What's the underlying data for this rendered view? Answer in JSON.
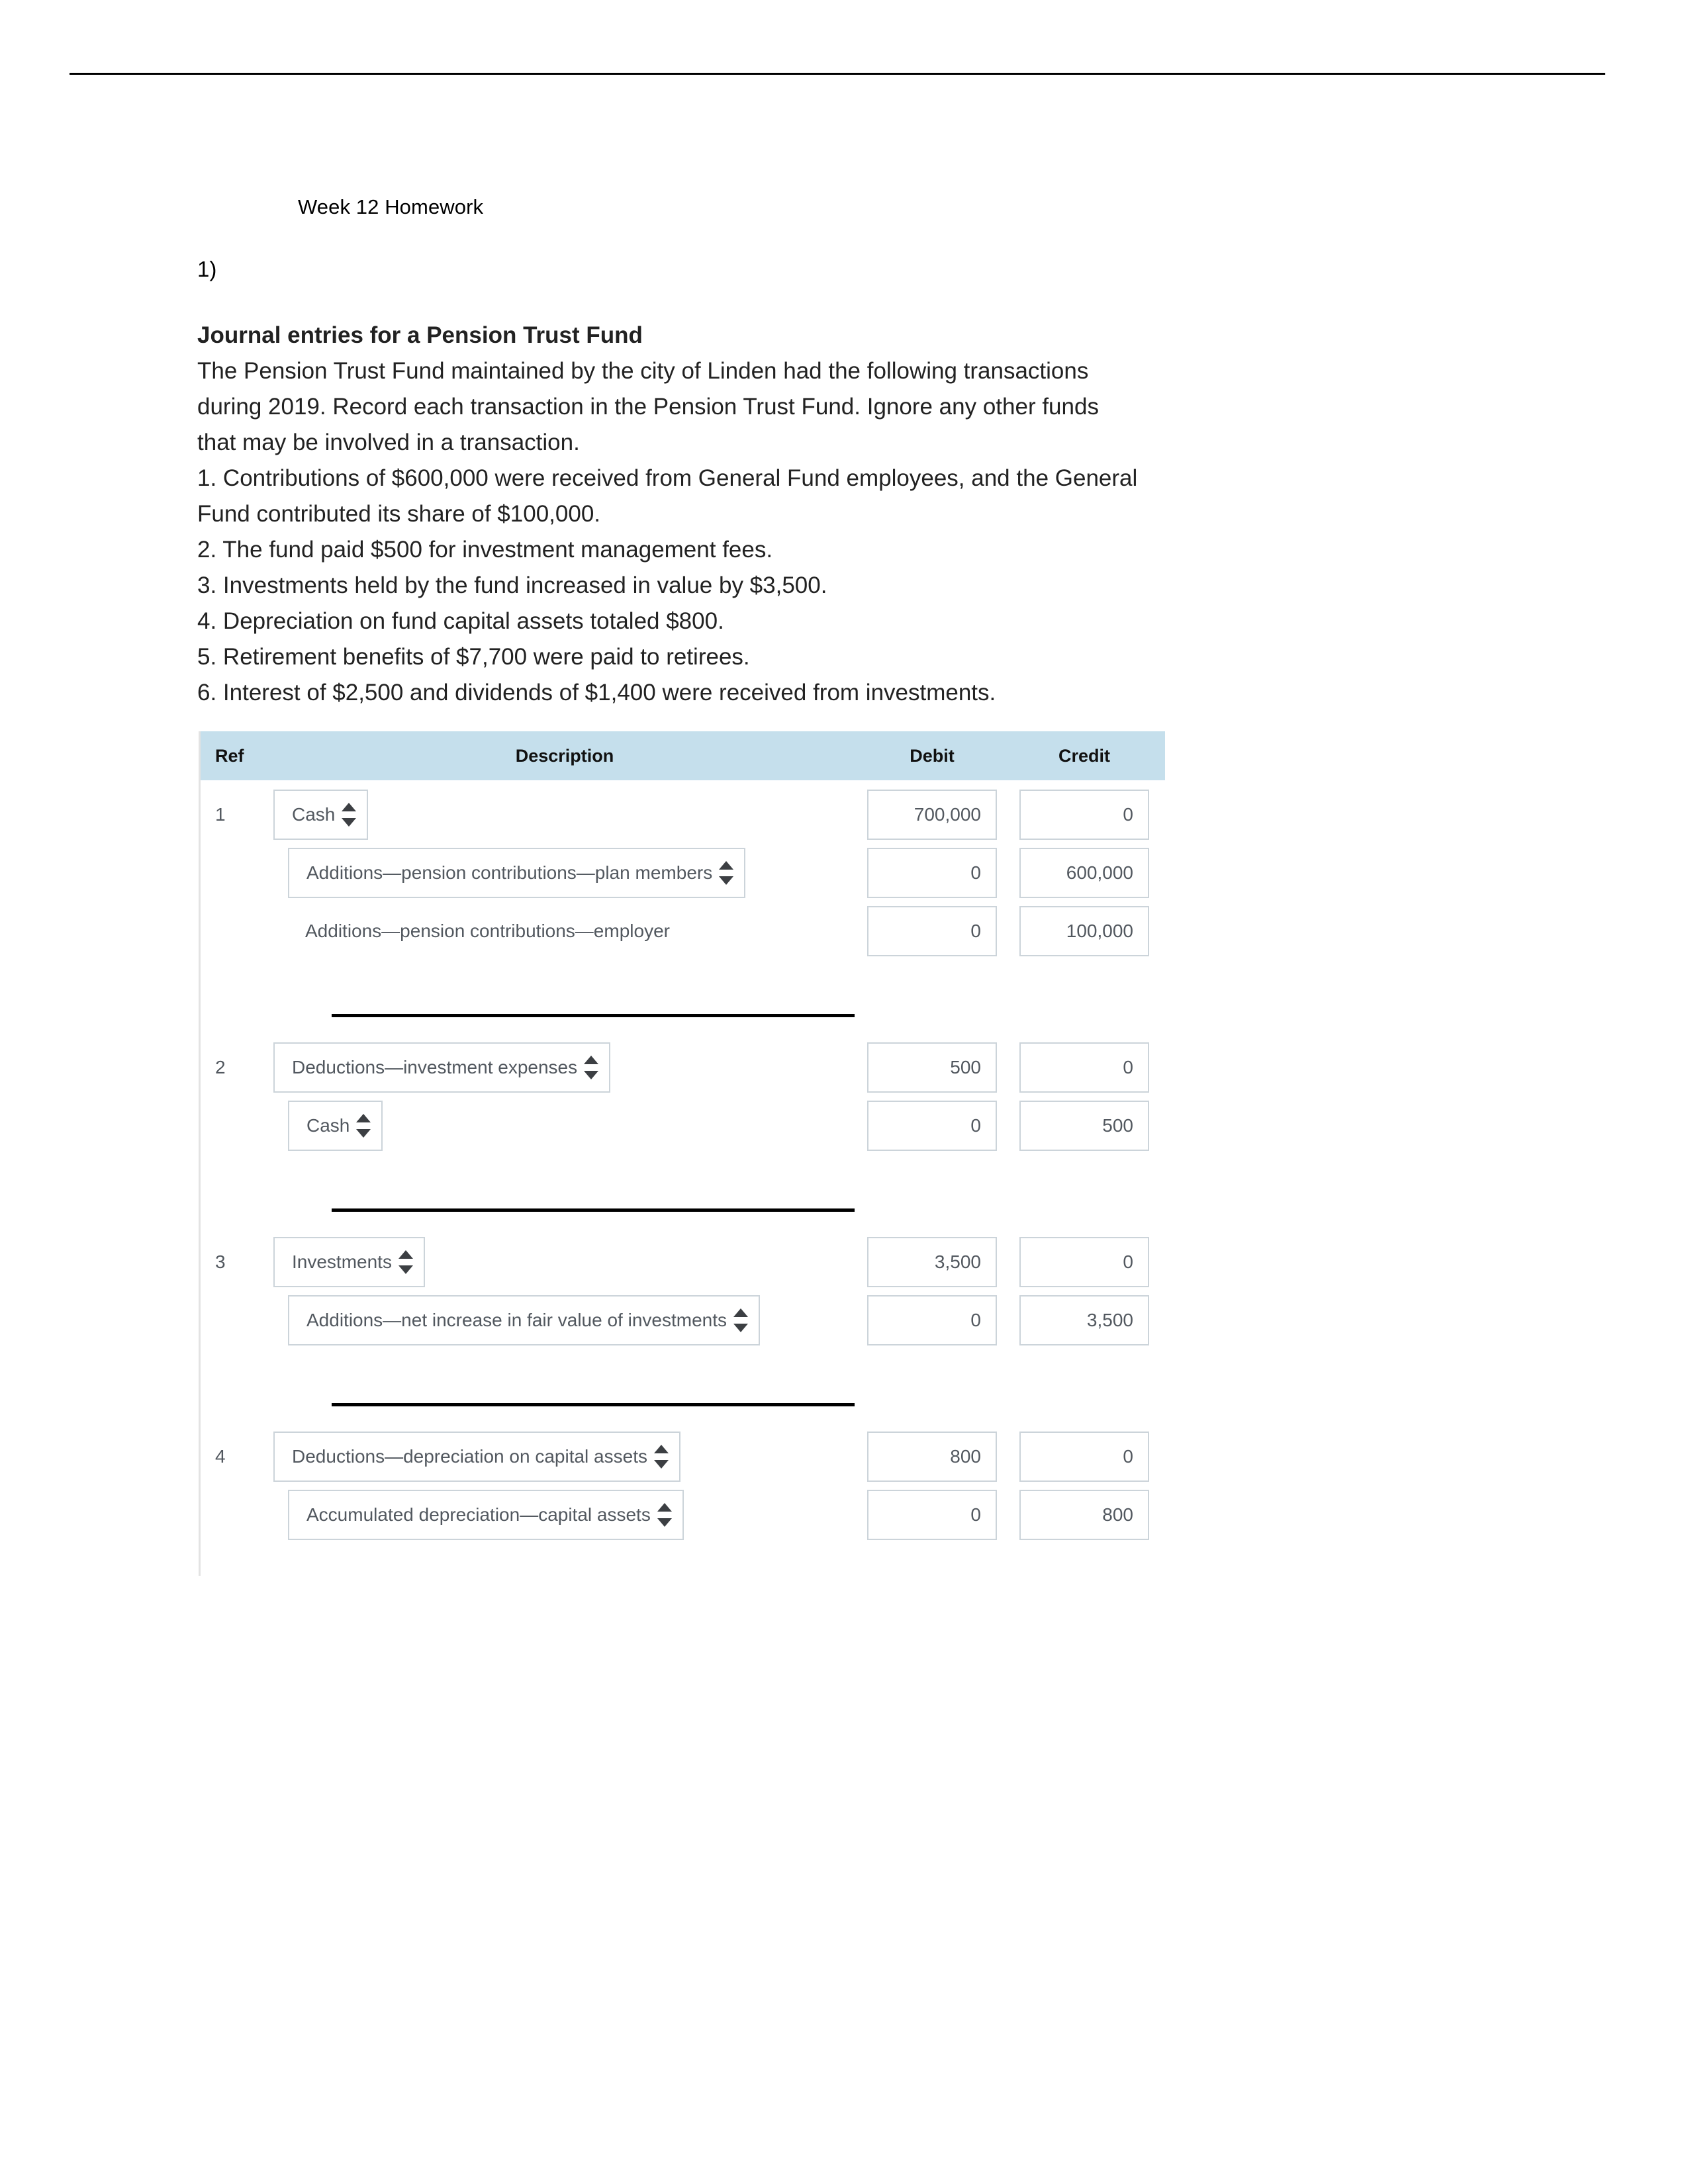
{
  "document": {
    "header_title": "Week 12 Homework",
    "question_number": "1)",
    "exercise_title": "Journal entries for a Pension Trust Fund",
    "intro_lines": [
      "The Pension Trust Fund maintained by the city of Linden had the following transactions",
      "during 2019. Record each transaction in the Pension Trust Fund. Ignore any other funds",
      "that may be involved in a transaction."
    ],
    "transactions": [
      "1. Contributions of $600,000 were received from General Fund employees, and the General",
      "Fund contributed its share of $100,000.",
      "2. The fund paid $500 for investment management fees.",
      "3. Investments held by the fund increased in value by $3,500.",
      "4. Depreciation on fund capital assets totaled $800.",
      "5. Retirement benefits of $7,700 were paid to retirees.",
      "6. Interest of $2,500 and dividends of $1,400 were received from investments."
    ]
  },
  "colors": {
    "header_background": "#c5dfec",
    "field_border": "#ccd4da",
    "text": "#52585f",
    "rule": "#000000"
  },
  "journal": {
    "columns": {
      "ref": "Ref",
      "description": "Description",
      "debit": "Debit",
      "credit": "Credit"
    },
    "entries": [
      {
        "ref": "1",
        "lines": [
          {
            "kind": "select",
            "indent": 0,
            "description": "Cash",
            "debit": "700,000",
            "credit": "0"
          },
          {
            "kind": "select",
            "indent": 1,
            "description": "Additions—pension contributions—plan members",
            "debit": "0",
            "credit": "600,000"
          },
          {
            "kind": "text",
            "indent": 1,
            "description": "Additions—pension contributions—employer",
            "debit": "0",
            "credit": "100,000"
          }
        ]
      },
      {
        "ref": "2",
        "lines": [
          {
            "kind": "select",
            "indent": 0,
            "description": "Deductions—investment expenses",
            "debit": "500",
            "credit": "0"
          },
          {
            "kind": "select",
            "indent": 1,
            "description": "Cash",
            "debit": "0",
            "credit": "500"
          }
        ]
      },
      {
        "ref": "3",
        "lines": [
          {
            "kind": "select",
            "indent": 0,
            "description": "Investments",
            "debit": "3,500",
            "credit": "0"
          },
          {
            "kind": "select",
            "indent": 1,
            "description": "Additions—net increase in fair value of investments",
            "debit": "0",
            "credit": "3,500"
          }
        ]
      },
      {
        "ref": "4",
        "lines": [
          {
            "kind": "select",
            "indent": 0,
            "description": "Deductions—depreciation on capital assets",
            "debit": "800",
            "credit": "0"
          },
          {
            "kind": "select",
            "indent": 1,
            "description": "Accumulated depreciation—capital assets",
            "debit": "0",
            "credit": "800"
          }
        ]
      }
    ]
  }
}
